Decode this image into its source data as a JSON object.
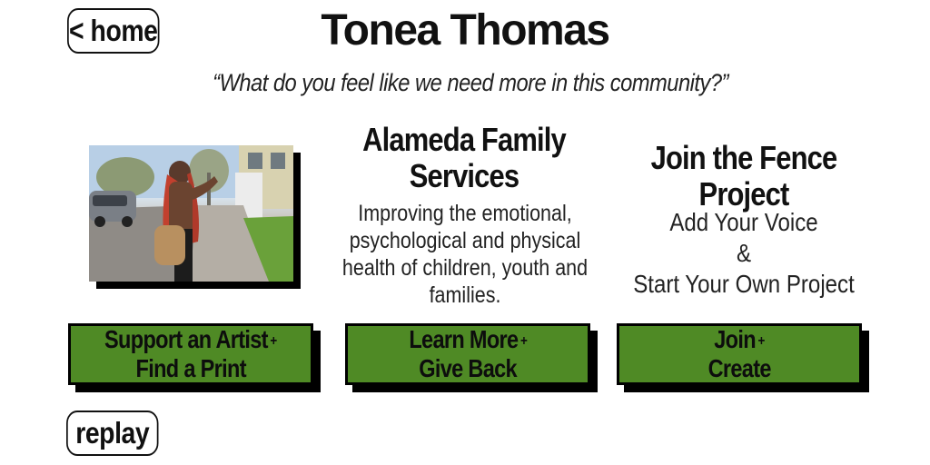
{
  "nav": {
    "home_label": "< home",
    "replay_label": "replay"
  },
  "header": {
    "title": "Tonea Thomas",
    "question": "“What do you feel like we need more in this community?”"
  },
  "columns": {
    "artist": {
      "button_line1": "Support an Artist",
      "button_line2": "Find a Print",
      "plus": "+"
    },
    "afs": {
      "title": "Alameda Family Services",
      "description": "Improving the emotional, psychological and physical health of children, youth and families.",
      "button_line1": "Learn More",
      "button_line2": "Give Back",
      "plus": "+"
    },
    "fence": {
      "title": "Join the Fence Project",
      "line1": "Add Your Voice",
      "amp": "&",
      "line2": "Start Your Own Project",
      "button_line1": "Join",
      "button_line2": "Create",
      "plus": "+"
    }
  },
  "colors": {
    "button_green": "#4f8a25",
    "shadow": "#000000",
    "background": "#ffffff"
  }
}
